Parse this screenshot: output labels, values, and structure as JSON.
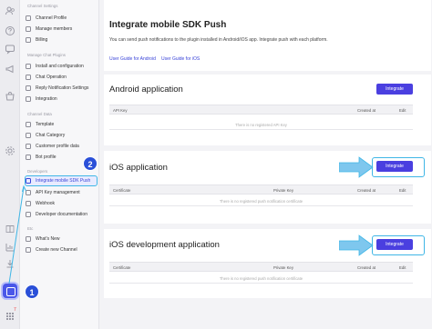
{
  "rail": {
    "icons": [
      "users-icon",
      "help-icon",
      "chat-icon",
      "megaphone-icon",
      "store-icon",
      "settings-icon",
      "book-icon",
      "chart-icon",
      "download-icon",
      "plugin-icon",
      "apps-icon"
    ],
    "badge": "7"
  },
  "sidebar": {
    "sections": [
      {
        "title": "Channel Settings",
        "items": [
          "Channel Profile",
          "Manage members",
          "Billing"
        ]
      },
      {
        "title": "Manage Chat Plugins",
        "items": [
          "Install and configuration",
          "Chat Operation",
          "Reply Notification Settings",
          "Integration"
        ]
      },
      {
        "title": "Channel Data",
        "items": [
          "Template",
          "Chat Category",
          "Customer profile data",
          "Bot profile"
        ]
      },
      {
        "title": "Developers",
        "items": [
          "Integrate mobile SDK Push",
          "API Key management",
          "Webhook",
          "Developer documentation"
        ]
      },
      {
        "title": "Etc",
        "items": [
          "What's New",
          "Create new Channel"
        ]
      }
    ],
    "active_item": "Integrate mobile SDK Push"
  },
  "main": {
    "title": "Integrate mobile SDK Push",
    "description": "You can send push notifications to the plugin installed in Android/iOS app. Integrate push with each platform.",
    "links": [
      "User Guide for Android",
      "User Guide for iOS"
    ],
    "sections": [
      {
        "title": "Android application",
        "button": "Integrate",
        "columns": [
          "API Key",
          "Created at",
          "Edit"
        ],
        "empty": "There is no registered API Key"
      },
      {
        "title": "iOS application",
        "button": "Integrate",
        "columns": [
          "Certificate",
          "Private Key",
          "Created at",
          "Edit"
        ],
        "empty": "There is no registered push notification certificate"
      },
      {
        "title": "iOS development application",
        "button": "Integrate",
        "columns": [
          "Certificate",
          "Private Key",
          "Created at",
          "Edit"
        ],
        "empty": "There is no registered push notification certificate"
      }
    ]
  },
  "callouts": {
    "step1": "1",
    "step2": "2"
  },
  "colors": {
    "accent": "#4a3fe0",
    "highlight": "#3fb6e6",
    "callout": "#2a4fd8"
  }
}
